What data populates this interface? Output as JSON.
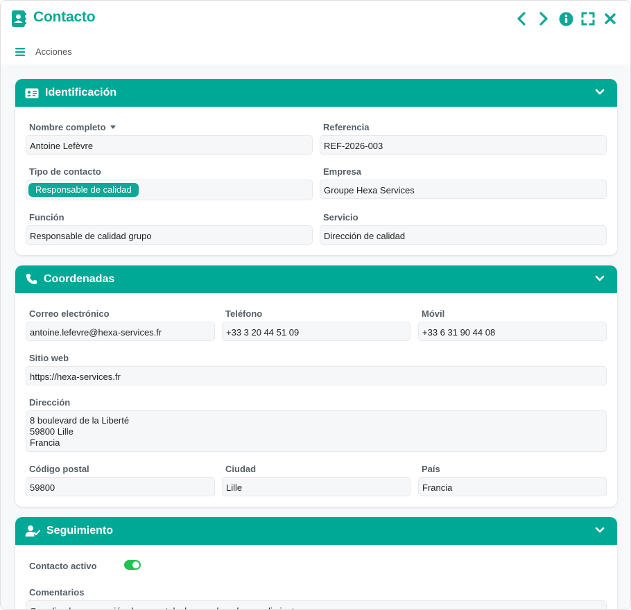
{
  "window": {
    "title": "Contacto",
    "toolbar_label": "Acciones"
  },
  "colors": {
    "accent": "#00a896",
    "title": "#0ea896",
    "toggle_on": "#21c154"
  },
  "icons": {
    "title": "address-book-icon",
    "prev": "chevron-left-icon",
    "next": "chevron-right-icon",
    "info": "info-icon",
    "fullscreen": "expand-icon",
    "close": "close-icon",
    "menu": "hamburger-menu-icon"
  },
  "identificacion": {
    "title": "Identificación",
    "fields": {
      "nombre": {
        "label": "Nombre completo",
        "value": "Antoine Lefèvre"
      },
      "referencia": {
        "label": "Referencia",
        "value": "REF-2026-003"
      },
      "tipo": {
        "label": "Tipo de contacto",
        "tag": "Responsable de calidad"
      },
      "empresa": {
        "label": "Empresa",
        "value": "Groupe Hexa Services"
      },
      "funcion": {
        "label": "Función",
        "value": "Responsable de calidad grupo"
      },
      "servicio": {
        "label": "Servicio",
        "value": "Dirección de calidad"
      }
    }
  },
  "coordenadas": {
    "title": "Coordenadas",
    "fields": {
      "correo": {
        "label": "Correo electrónico",
        "value": "antoine.lefevre@hexa-services.fr"
      },
      "telefono": {
        "label": "Teléfono",
        "value": "+33 3 20 44 51 09"
      },
      "movil": {
        "label": "Móvil",
        "value": "+33 6 31 90 44 08"
      },
      "web": {
        "label": "Sitio web",
        "value": "https://hexa-services.fr"
      },
      "direccion": {
        "label": "Dirección",
        "lines": [
          "8 boulevard de la Liberté",
          "59800 Lille",
          "Francia"
        ]
      },
      "cp": {
        "label": "Código postal",
        "value": "59800"
      },
      "ciudad": {
        "label": "Ciudad",
        "value": "Lille"
      },
      "pais": {
        "label": "País",
        "value": "Francia"
      }
    }
  },
  "seguimiento": {
    "title": "Seguimiento",
    "activo_label": "Contacto activo",
    "activo": true,
    "comentarios_label": "Comentarios",
    "comentarios_value": "Coordina la preparación documental y las pruebas de cumplimiento"
  }
}
